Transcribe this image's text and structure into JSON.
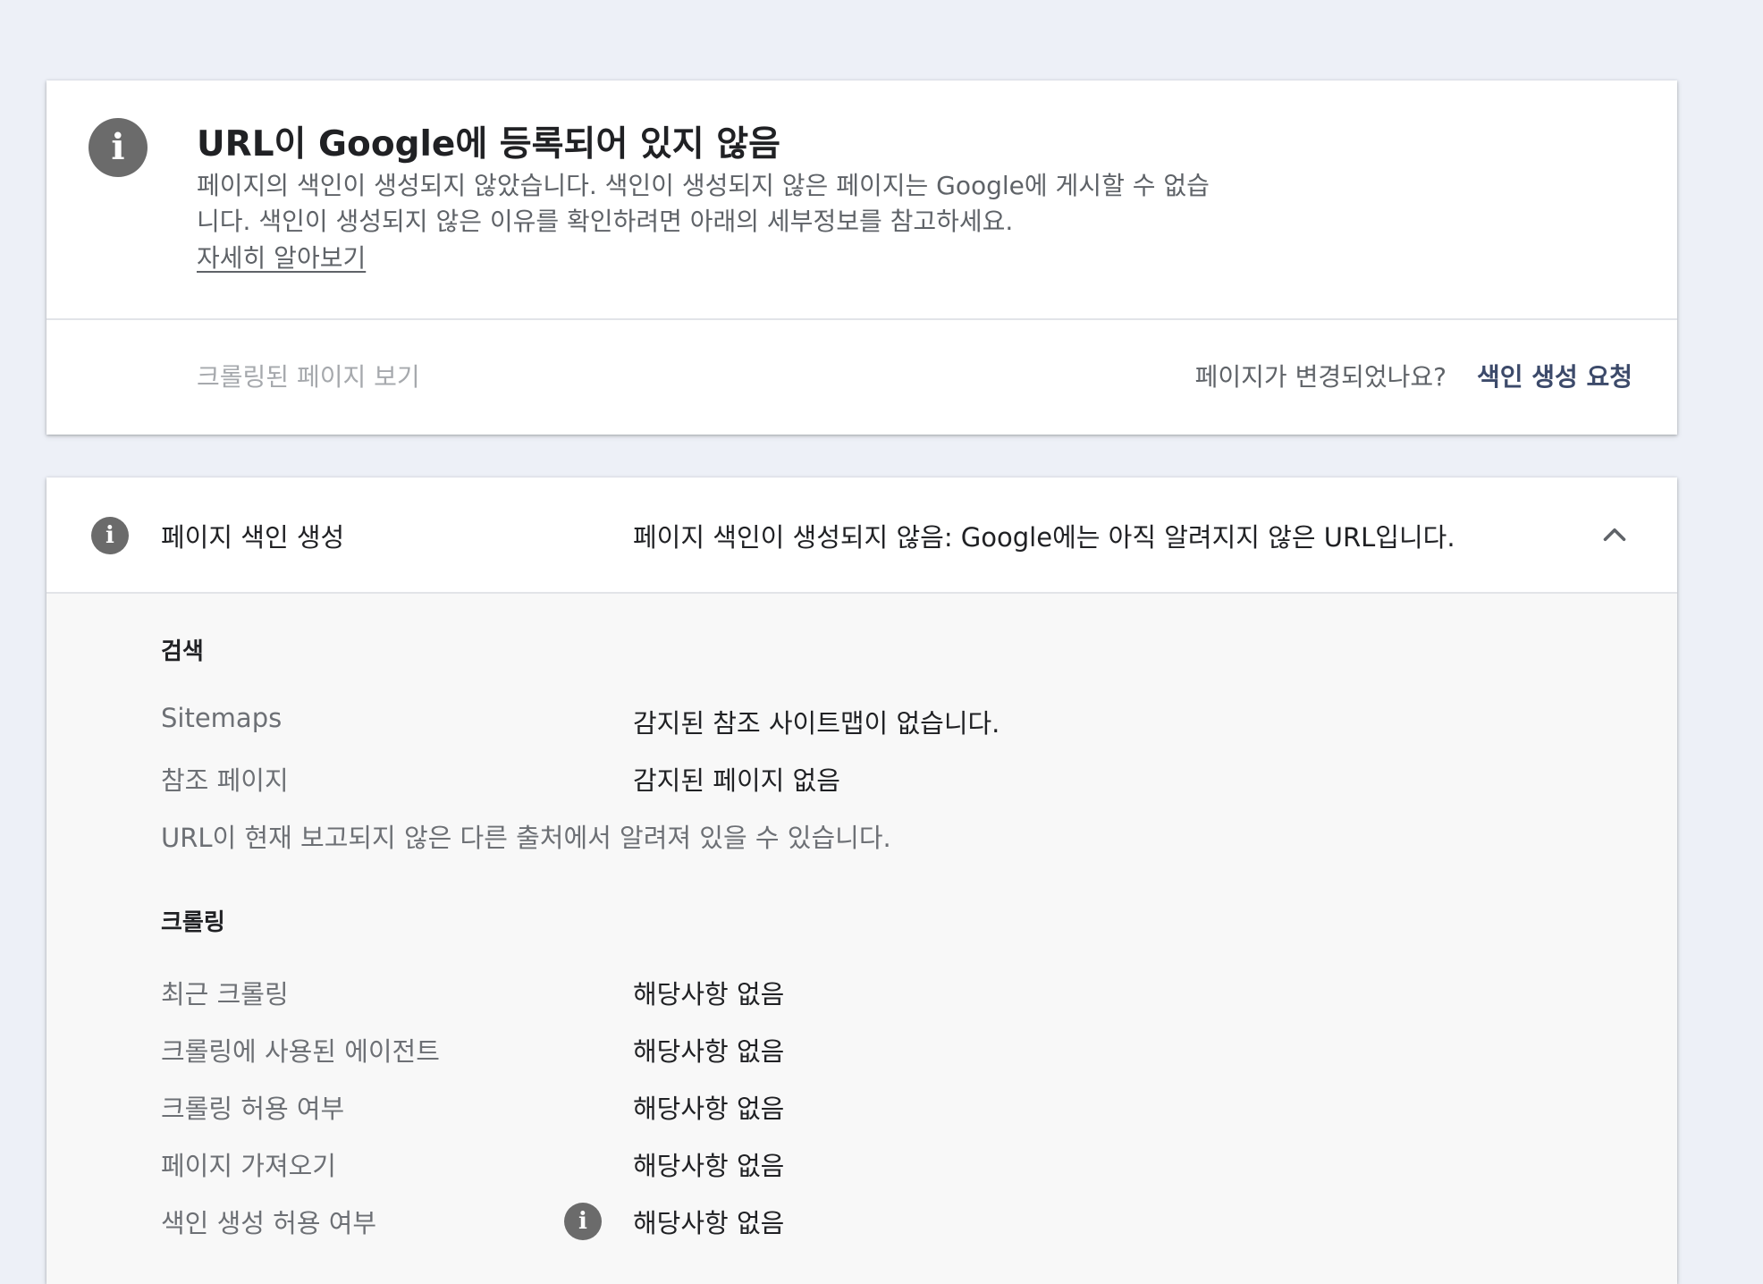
{
  "status": {
    "icon": "info-icon",
    "title": "URL이 Google에 등록되어 있지 않음",
    "description": "페이지의 색인이 생성되지 않았습니다. 색인이 생성되지 않은 페이지는 Google에 게시할 수 없습니다. 색인이 생성되지 않은 이유를 확인하려면 아래의 세부정보를 참고하세요.",
    "learn_more": "자세히 알아보기",
    "view_crawled": "크롤링된 페이지 보기",
    "changed_question": "페이지가 변경되었나요?",
    "request_indexing": "색인 생성 요청"
  },
  "detail": {
    "icon": "info-icon",
    "label": "페이지 색인 생성",
    "value": "페이지 색인이 생성되지 않음: Google에는 아직 알려지지 않은 URL입니다.",
    "expanded": true,
    "discovery": {
      "heading": "검색",
      "rows": [
        {
          "label": "Sitemaps",
          "value": "감지된 참조 사이트맵이 없습니다."
        },
        {
          "label": "참조 페이지",
          "value": "감지된 페이지 없음"
        }
      ],
      "note": "URL이 현재 보고되지 않은 다른 출처에서 알려져 있을 수 있습니다."
    },
    "crawl": {
      "heading": "크롤링",
      "rows": [
        {
          "label": "최근 크롤링",
          "value": "해당사항 없음"
        },
        {
          "label": "크롤링에 사용된 에이전트",
          "value": "해당사항 없음"
        },
        {
          "label": "크롤링 허용 여부",
          "value": "해당사항 없음"
        },
        {
          "label": "페이지 가져오기",
          "value": "해당사항 없음"
        },
        {
          "label": "색인 생성 허용 여부",
          "value": "해당사항 없음",
          "icon": "info-icon"
        }
      ]
    }
  },
  "colors": {
    "background": "#edf0f7",
    "card": "#ffffff",
    "body_panel": "#f8f8f8",
    "icon_gray": "#6b6b6b",
    "link_accent": "#3c4a6a",
    "muted_text": "#5f6368"
  }
}
